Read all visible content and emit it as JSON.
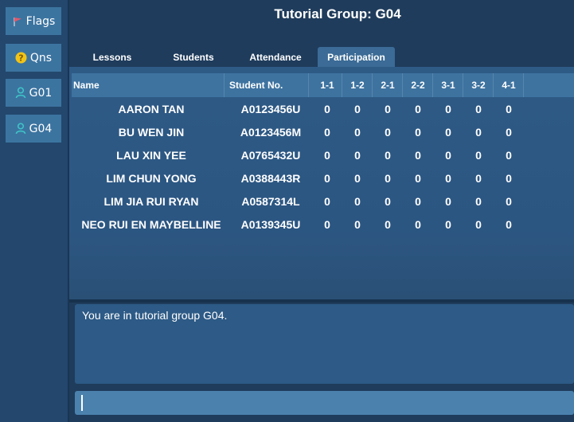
{
  "sidebar": {
    "items": [
      {
        "label": "Flags",
        "icon": "flag-icon"
      },
      {
        "label": "Qns",
        "icon": "question-icon"
      },
      {
        "label": "G01",
        "icon": "person-icon"
      },
      {
        "label": "G04",
        "icon": "person-icon"
      }
    ]
  },
  "header": {
    "title": "Tutorial Group: G04"
  },
  "tabs": [
    {
      "label": "Lessons"
    },
    {
      "label": "Students"
    },
    {
      "label": "Attendance"
    },
    {
      "label": "Participation",
      "active": true
    }
  ],
  "table": {
    "columns": [
      "Name",
      "Student No.",
      "1-1",
      "1-2",
      "2-1",
      "2-2",
      "3-1",
      "3-2",
      "4-1"
    ],
    "rows": [
      {
        "name": "AARON TAN",
        "student_no": "A0123456U",
        "scores": [
          "0",
          "0",
          "0",
          "0",
          "0",
          "0",
          "0"
        ]
      },
      {
        "name": "BU WEN JIN",
        "student_no": "A0123456M",
        "scores": [
          "0",
          "0",
          "0",
          "0",
          "0",
          "0",
          "0"
        ]
      },
      {
        "name": "LAU XIN YEE",
        "student_no": "A0765432U",
        "scores": [
          "0",
          "0",
          "0",
          "0",
          "0",
          "0",
          "0"
        ]
      },
      {
        "name": "LIM CHUN YONG",
        "student_no": "A0388443R",
        "scores": [
          "0",
          "0",
          "0",
          "0",
          "0",
          "0",
          "0"
        ]
      },
      {
        "name": "LIM JIA RUI RYAN",
        "student_no": "A0587314L",
        "scores": [
          "0",
          "0",
          "0",
          "0",
          "0",
          "0",
          "0"
        ]
      },
      {
        "name": "NEO RUI EN MAYBELLINE",
        "student_no": "A0139345U",
        "scores": [
          "0",
          "0",
          "0",
          "0",
          "0",
          "0",
          "0"
        ]
      }
    ]
  },
  "result": {
    "message": "You are in tutorial group G04."
  },
  "command": {
    "value": ""
  },
  "colors": {
    "background": "#1f3c5c",
    "sidebar_button": "#3c74a0",
    "table_header": "#3e73a0",
    "active_tab": "#3b6b96",
    "command_box": "#4b82ad",
    "flag_red": "#e05a6e",
    "question_yellow": "#f2c417",
    "person_teal": "#3ec6c8"
  }
}
